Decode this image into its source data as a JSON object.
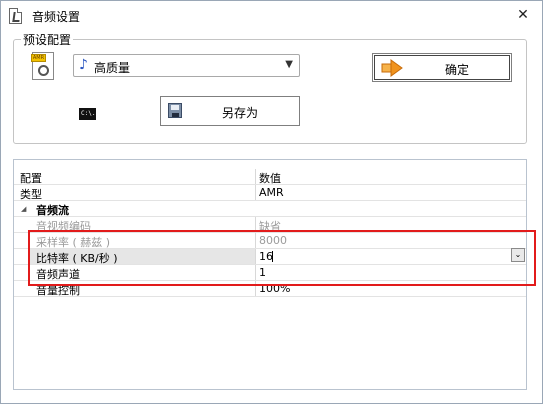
{
  "window": {
    "title": "音频设置",
    "close_glyph": "✕"
  },
  "preset": {
    "group_label": "预设配置",
    "selected": "高质量",
    "ok_label": "确定",
    "save_as_label": "另存为",
    "icon_tag": "AMR",
    "cmd_text": "C:\\."
  },
  "grid": {
    "header": [
      "配置",
      "数值"
    ],
    "rows": [
      {
        "key": "类型",
        "value": "AMR"
      },
      {
        "section": "音频流"
      },
      {
        "key": "音视频编码",
        "value": "缺省"
      },
      {
        "key": "采样率 ( 赫兹 )",
        "value": "8000"
      },
      {
        "key": "比特率 ( KB/秒 )",
        "value": "16"
      },
      {
        "key": "音频声道",
        "value": "1"
      },
      {
        "key": "音量控制",
        "value": "100%"
      }
    ]
  },
  "colors": {
    "highlight": "#e21b1b",
    "ok_arrow": "#f0931e"
  }
}
